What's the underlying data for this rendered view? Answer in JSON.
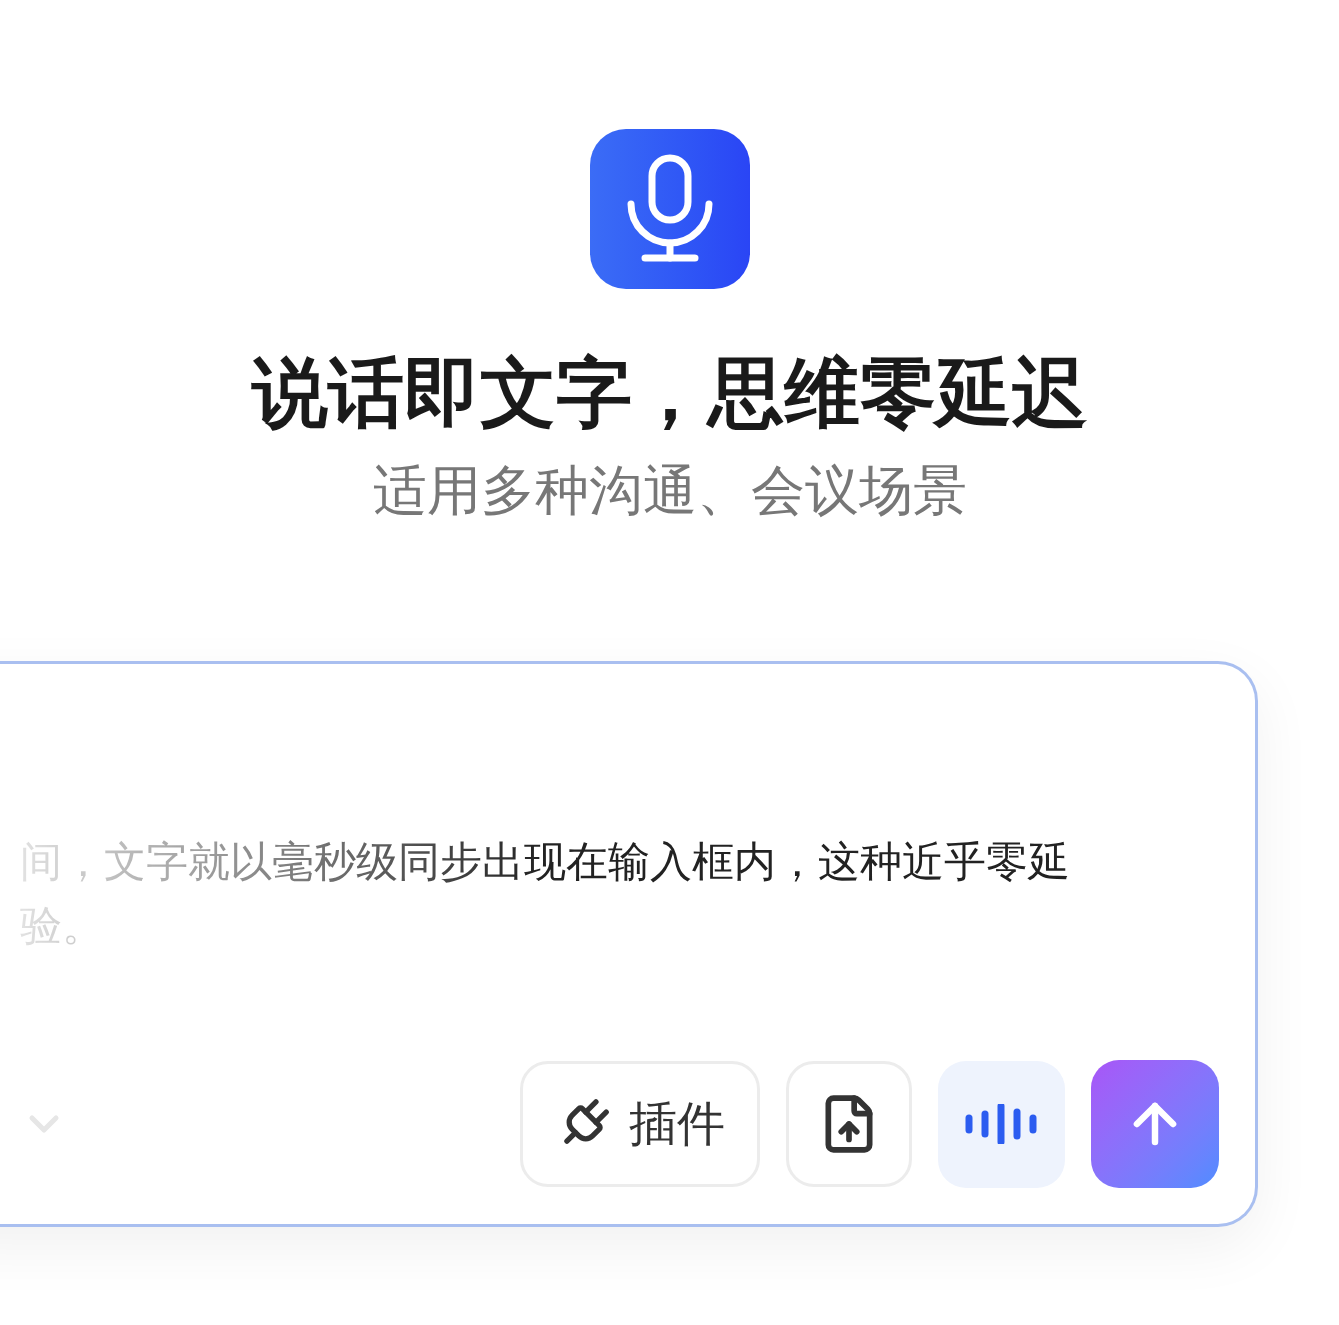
{
  "hero": {
    "title": "说话即文字，思维零延迟",
    "subtitle": "适用多种沟通、会议场景"
  },
  "composer": {
    "text_lines": [
      "间，文字就以毫秒级同步出现在输入框内，这种近乎零延",
      "验。"
    ],
    "toolbar": [
      {
        "kind": "plugin",
        "label": "插件"
      },
      {
        "kind": "upload"
      },
      {
        "kind": "voice"
      },
      {
        "kind": "send"
      }
    ]
  }
}
